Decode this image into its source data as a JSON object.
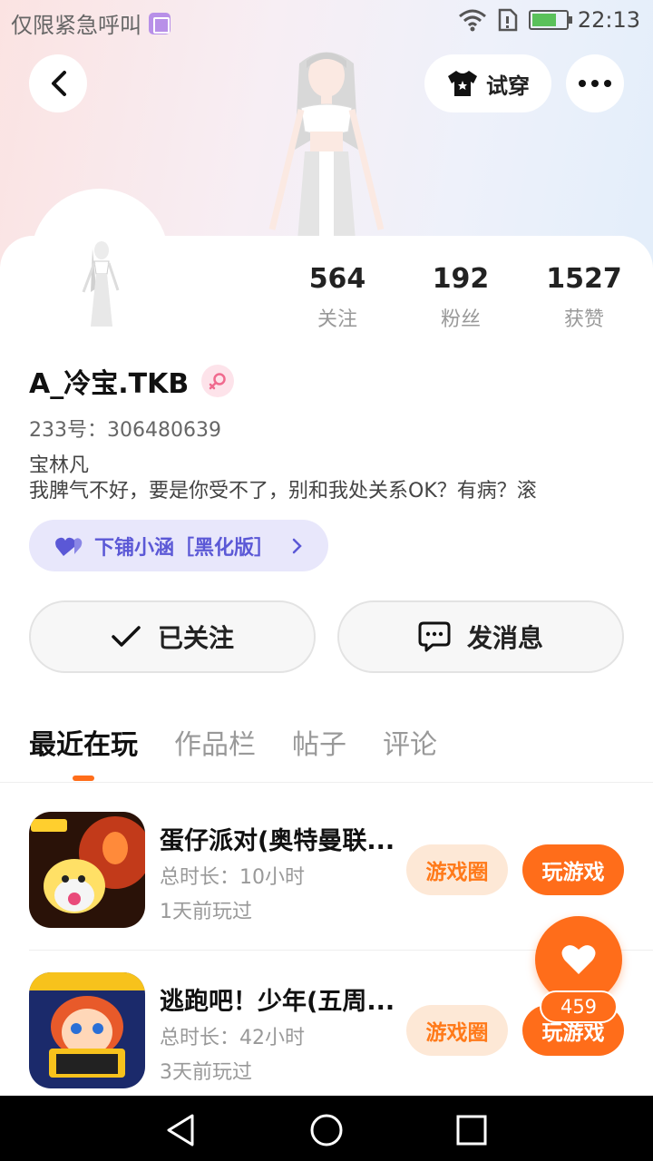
{
  "status": {
    "carrier_text": "仅限紧急呼叫",
    "time": "22:13",
    "icons": [
      "sim-icon",
      "wifi-icon",
      "sim-alert-icon",
      "battery-charging-icon"
    ]
  },
  "header": {
    "tryon_label": "试穿",
    "icons": [
      "back-icon",
      "tshirt-icon",
      "more-icon"
    ]
  },
  "profile": {
    "stats": [
      {
        "value": "564",
        "label": "关注"
      },
      {
        "value": "192",
        "label": "粉丝"
      },
      {
        "value": "1527",
        "label": "获赞"
      }
    ],
    "username": "A_冷宝.TKB",
    "gender": "female",
    "uid": "233号：306480639",
    "bio_line1": "宝林凡",
    "bio_line2": "我脾气不好，要是你受不了，别和我处关系OK？有病？滚",
    "guild": "下铺小涵［黑化版］"
  },
  "actions": {
    "follow_label": "已关注",
    "message_label": "发消息"
  },
  "tabs": [
    {
      "label": "最近在玩",
      "active": true
    },
    {
      "label": "作品栏",
      "active": false
    },
    {
      "label": "帖子",
      "active": false
    },
    {
      "label": "评论",
      "active": false
    }
  ],
  "games": [
    {
      "title": "蛋仔派对(奥特曼联...",
      "duration": "总时长：10小时",
      "last_played": "1天前玩过",
      "circle_label": "游戏圈",
      "play_label": "玩游戏"
    },
    {
      "title": "逃跑吧！少年(五周...",
      "duration": "总时长：42小时",
      "last_played": "3天前玩过",
      "circle_label": "游戏圈",
      "play_label": "玩游戏"
    }
  ],
  "like": {
    "count": "459"
  },
  "colors": {
    "accent": "#ff6d1a",
    "guild_text": "#5b58d6",
    "guild_bg": "#e8e7fb"
  }
}
